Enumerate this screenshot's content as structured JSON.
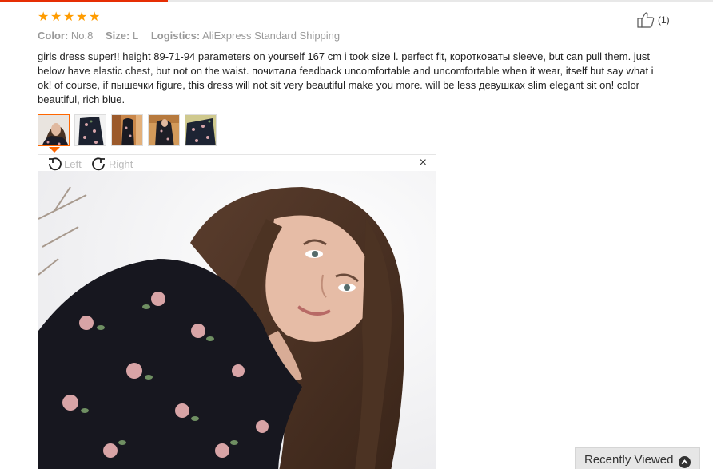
{
  "review": {
    "rating": 5,
    "likes_label": "(1)",
    "color_label": "Color:",
    "color_value": "No.8",
    "size_label": "Size:",
    "size_value": "L",
    "logistics_label": "Logistics:",
    "logistics_value": "AliExpress Standard Shipping",
    "text": "girls dress super!! height 89-71-94 parameters on yourself 167 cm i took size l. perfect fit, коротковаты sleeve, but can pull them. just below have elastic chest, but not on the waist. почитала feedback uncomfortable and uncomfortable when it wear, itself but say what i ok! of course, if пышечки figure, this dress will not sit very beautiful make you more. will be less девушках slim elegant sit on! color beautiful, rich blue."
  },
  "thumbnails": [
    {
      "selected": true
    },
    {
      "selected": false
    },
    {
      "selected": false
    },
    {
      "selected": false
    },
    {
      "selected": false
    }
  ],
  "viewer": {
    "rotate_left_label": "Left",
    "rotate_right_label": "Right",
    "close_symbol": "×"
  },
  "recently_viewed": {
    "label": "Recently Viewed"
  },
  "colors": {
    "star": "#ff9c00",
    "accent": "#e62e04",
    "selected_border": "#ff6600"
  },
  "icons": {
    "like": "thumbs-up-icon",
    "rotate_left": "rotate-left-icon",
    "rotate_right": "rotate-right-icon",
    "close": "close-icon",
    "recent_toggle": "chevron-up-icon"
  }
}
